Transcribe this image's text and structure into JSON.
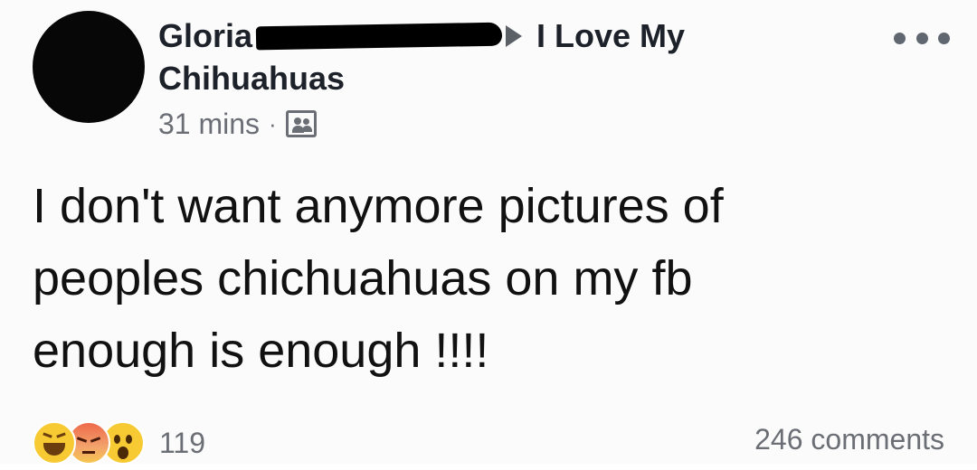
{
  "post": {
    "author": "Gloria",
    "group_line1": "I Love My",
    "group_line2": "Chihuahuas",
    "timestamp": "31 mins",
    "separator": "·",
    "audience_icon": "group-audience-icon",
    "more_icon": "more-options-icon",
    "body_lines": [
      "I don't want anymore pictures of",
      "peoples chichuahuas on my fb",
      "enough is enough !!!!"
    ],
    "reactions": {
      "icons": [
        "haha-icon",
        "angry-icon",
        "wow-icon"
      ],
      "count": "119"
    },
    "comments": "246 comments"
  }
}
